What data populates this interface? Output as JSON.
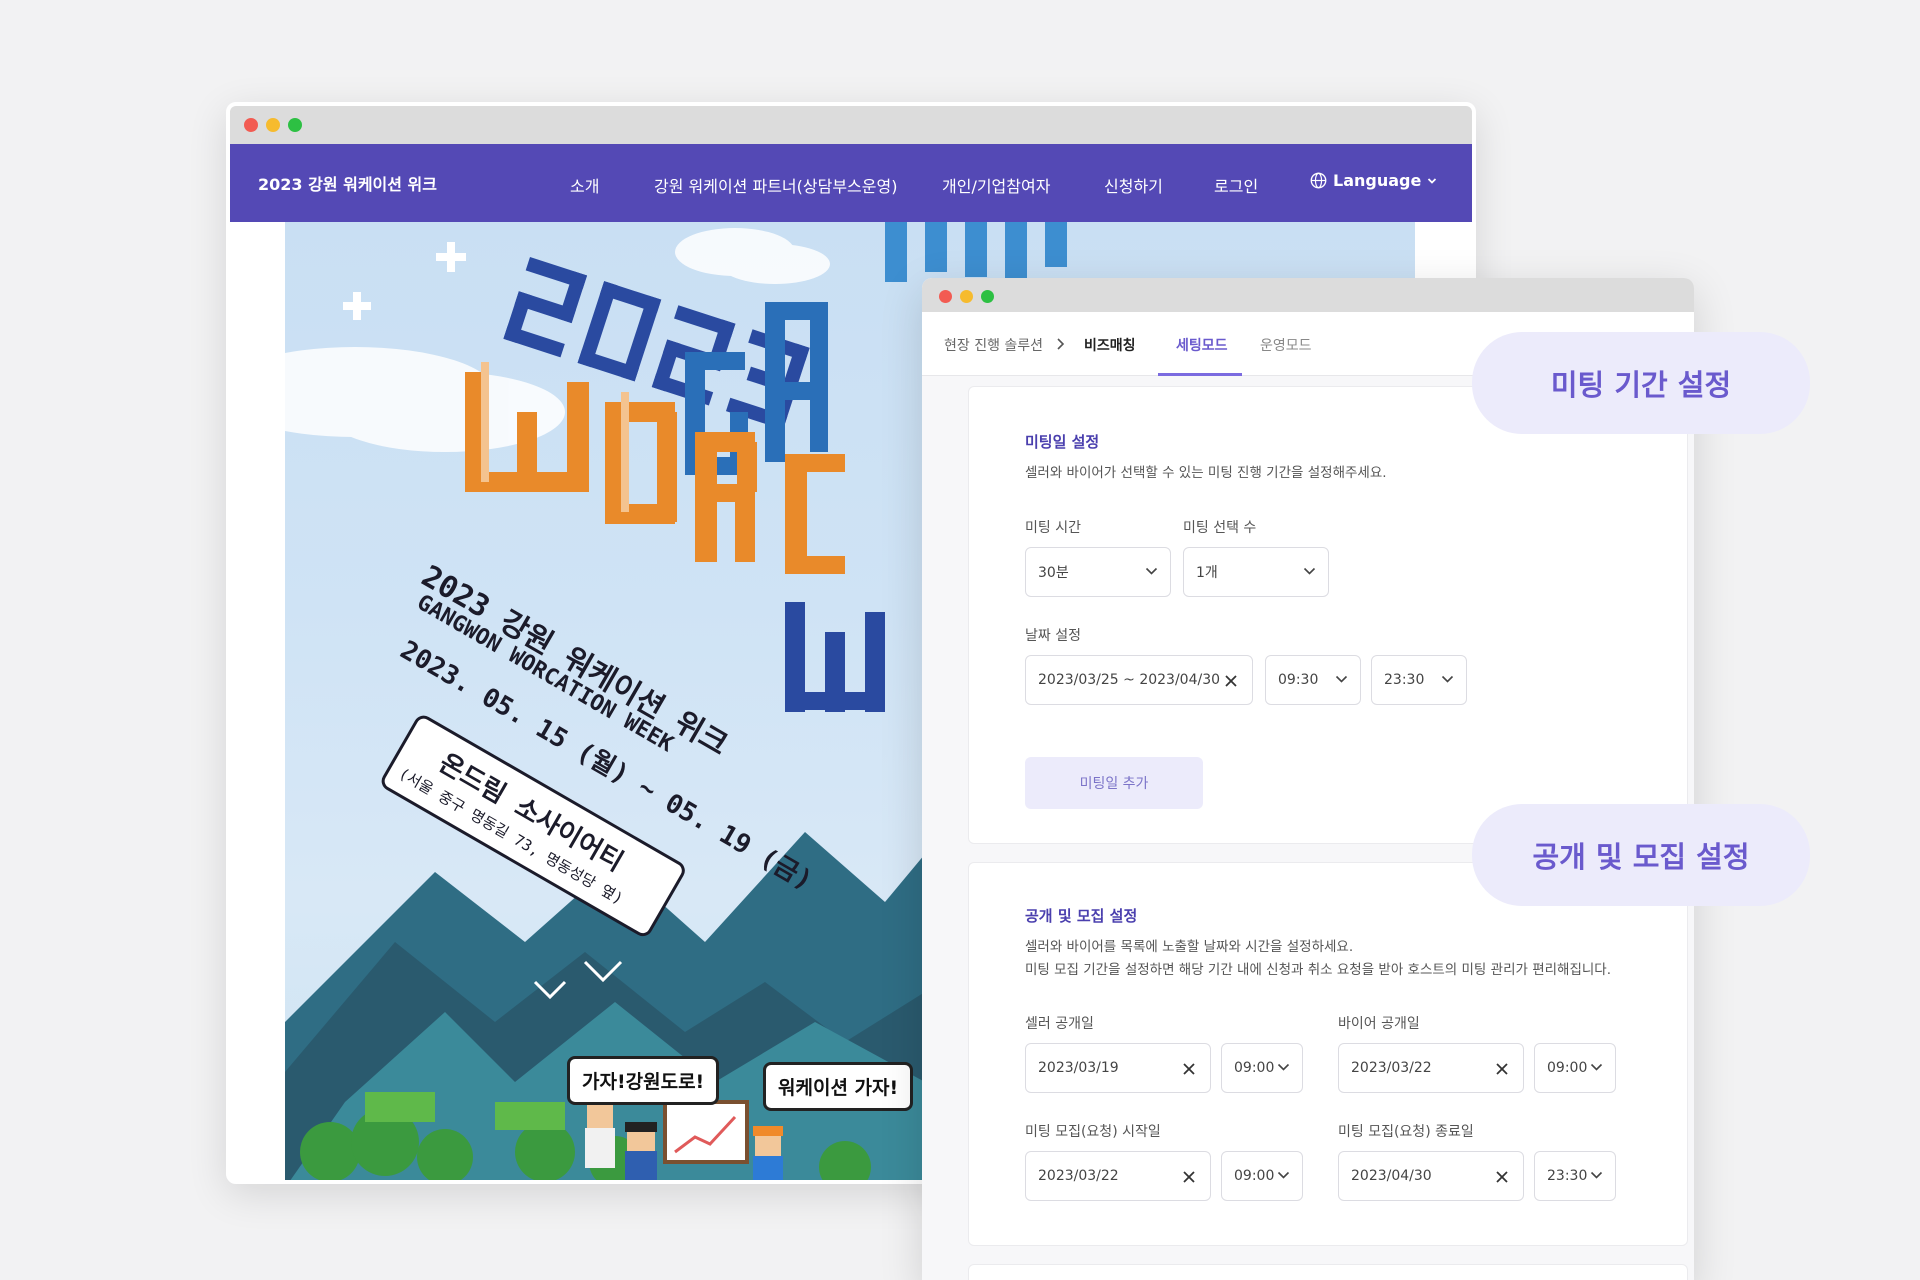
{
  "back_window": {
    "site_title": "2023 강원 워케이션 위크",
    "nav": [
      "소개",
      "강원 워케이션 파트너(상담부스운영)",
      "개인/기업참여자",
      "신청하기",
      "로그인"
    ],
    "language_label": "Language",
    "poster": {
      "headline_lines": [
        "2023",
        "GA",
        "WOR",
        "CA",
        "W"
      ],
      "title_ko": "2023 강원 워케이션 위크",
      "title_en": "GANGWON WORCATION WEEK",
      "dates": "2023. 05. 15 (월) ~ 05. 19 (금)",
      "venue": "온드림 소사이어티",
      "venue_address": "(서울 중구 명동길 73, 명동성당 옆)",
      "bubble_left": "가자!강원도로!",
      "bubble_right": "워케이션 가자!"
    }
  },
  "front_window": {
    "breadcrumb": [
      "현장 진행 솔루션",
      "비즈매칭"
    ],
    "tabs": [
      {
        "label": "세팅모드",
        "active": true
      },
      {
        "label": "운영모드",
        "active": false
      }
    ],
    "meeting_card": {
      "title": "미팅일 설정",
      "desc": "셀러와 바이어가 선택할 수 있는 미팅 진행 기간을 설정해주세요.",
      "time_label": "미팅 시간",
      "time_value": "30분",
      "count_label": "미팅 선택 수",
      "count_value": "1개",
      "date_label": "날짜 설정",
      "date_range": "2023/03/25 ~ 2023/04/30",
      "start_time": "09:30",
      "end_time": "23:30",
      "add_button": "미팅일 추가"
    },
    "public_card": {
      "title": "공개 및 모집 설정",
      "desc1": "셀러와 바이어를 목록에 노출할 날짜와 시간을 설정하세요.",
      "desc2": "미팅 모집 기간을 설정하면 해당 기간 내에 신청과 취소 요청을 받아 호스트의 미팅 관리가 편리해집니다.",
      "seller_open_label": "셀러 공개일",
      "seller_open_date": "2023/03/19",
      "seller_open_time": "09:00",
      "buyer_open_label": "바이어 공개일",
      "buyer_open_date": "2023/03/22",
      "buyer_open_time": "09:00",
      "recruit_start_label": "미팅 모집(요청) 시작일",
      "recruit_start_date": "2023/03/22",
      "recruit_start_time": "09:00",
      "recruit_end_label": "미팅 모집(요청) 종료일",
      "recruit_end_date": "2023/04/30",
      "recruit_end_time": "23:30"
    }
  },
  "pills": {
    "meeting_period": "미팅 기간 설정",
    "public_recruit": "공개 및 모집 설정"
  },
  "colors": {
    "nav_bg": "#5449b5",
    "accent": "#6a5acd",
    "pill_bg": "#ecebfb"
  }
}
